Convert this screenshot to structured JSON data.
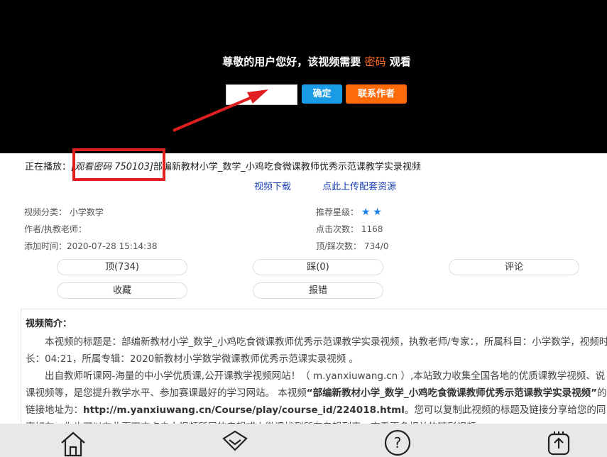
{
  "player": {
    "prompt_prefix": "尊敬的用户您好，该视频需要",
    "prompt_highlight": "密码",
    "prompt_suffix": "观看",
    "password_value": "",
    "confirm_label": "确定",
    "contact_label": "联系作者"
  },
  "now_playing": {
    "label": "正在播放：",
    "password_hint": "[观看密码 750103]",
    "title": "部编新教材小学_数学_小鸡吃食微课教师优秀示范课教学实录视频"
  },
  "links": {
    "download": "视频下载",
    "upload": "点此上传配套资源"
  },
  "meta": {
    "category_label": "视频分类：",
    "category_value": "小学数学",
    "author_label": "作者/执教老师：",
    "author_value": "",
    "added_label": "添加时间：",
    "added_value": "2020-07-28 15:14:38",
    "rating_label": "推荐星级：",
    "rating_stars": 2,
    "clicks_label": "点击次数：",
    "clicks_value": "1168",
    "votes_label": "顶/踩次数：",
    "votes_value": "734/0"
  },
  "actions": {
    "up": "顶(734)",
    "down": "踩(0)",
    "comment": "评论",
    "favorite": "收藏",
    "report": "报错"
  },
  "intro": {
    "title": "视频简介：",
    "p1": "本视频的标题是：部编新教材小学_数学_小鸡吃食微课教师优秀示范课教学实录视频，执教老师/专家：，所属科目：小学数学，视频时长：04:21，所属专辑：2020新教材小学数学微课教师优秀示范课实录视频 。",
    "p2_a": "出自教师听课网-海量的中小学优质课,公开课教学视频网站！（ m.yanxiuwang.cn ）,本站致力收集全国各地的优质课教学视频、说课视频等，是您提升教学水平、参加赛课最好的学习网站。 本视频",
    "p2_b": "“部编新教材小学_数学_小鸡吃食微课教师优秀示范课教学实录视频”",
    "p2_c": "的链接地址为：",
    "p2_d": "http://m.yanxiuwang.cn/Course/play/course_id/224018.html",
    "p2_e": "。您可以复制此视频的标题及链接分享给您的同事好友，你也可以在此页下方点击本视频所属的专辑或上微课找到所有专辑列表，查看更多相关的精彩视频。"
  },
  "bottom_nav": [
    "home-icon",
    "discover-icon",
    "help-icon",
    "upload-icon"
  ]
}
